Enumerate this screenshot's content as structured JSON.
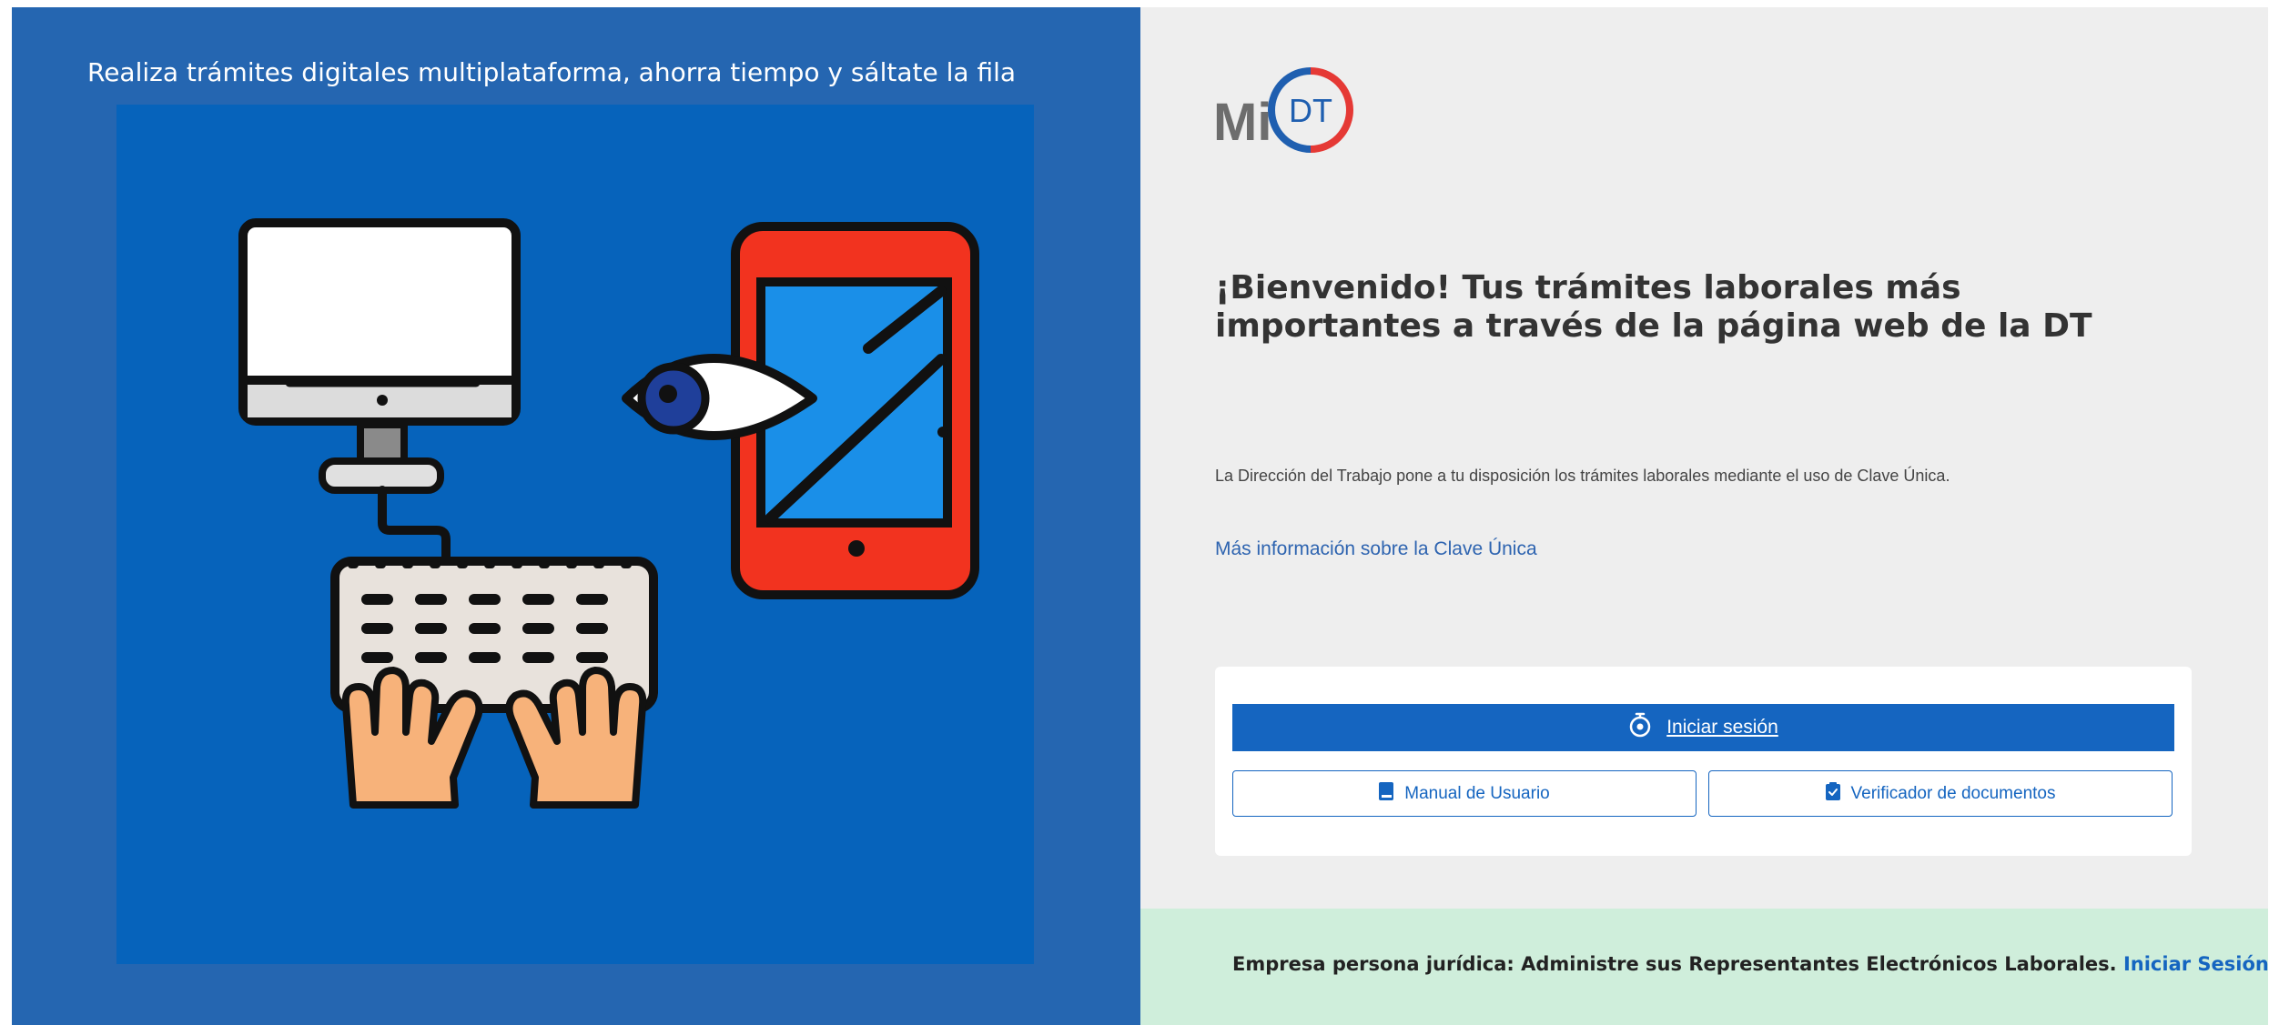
{
  "left": {
    "tagline": "Realiza trámites digitales multiplataforma, ahorra tiempo y sáltate la fila"
  },
  "logo": {
    "text_mi": "Mi",
    "text_dt": "DT"
  },
  "main": {
    "welcome_title": "¡Bienvenido! Tus trámites laborales más importantes a través de la página web de la DT",
    "intro_text": "La Dirección del Trabajo pone a tu disposición los trámites laborales mediante el uso de Clave Única.",
    "info_link": "Más información sobre la Clave Única"
  },
  "actions": {
    "login_label": "Iniciar sesión",
    "manual_label": "Manual de Usuario",
    "verifier_label": "Verificador de documentos"
  },
  "footer": {
    "text": "Empresa persona jurídica: Administre sus Representantes Electrónicos Laborales.",
    "link": "Iniciar Sesión"
  },
  "colors": {
    "left_bg": "#2566b1",
    "illustration_bg": "#0663bb",
    "right_bg": "#eeeeee",
    "primary": "#1565c0",
    "footer_bg": "#cfeedb",
    "logo_gray": "#6d6d6d",
    "logo_blue": "#1f5fb0",
    "logo_red": "#e53935"
  },
  "icons": {
    "login": "clave-unica-icon",
    "manual": "book-icon",
    "verifier": "clipboard-check-icon"
  }
}
